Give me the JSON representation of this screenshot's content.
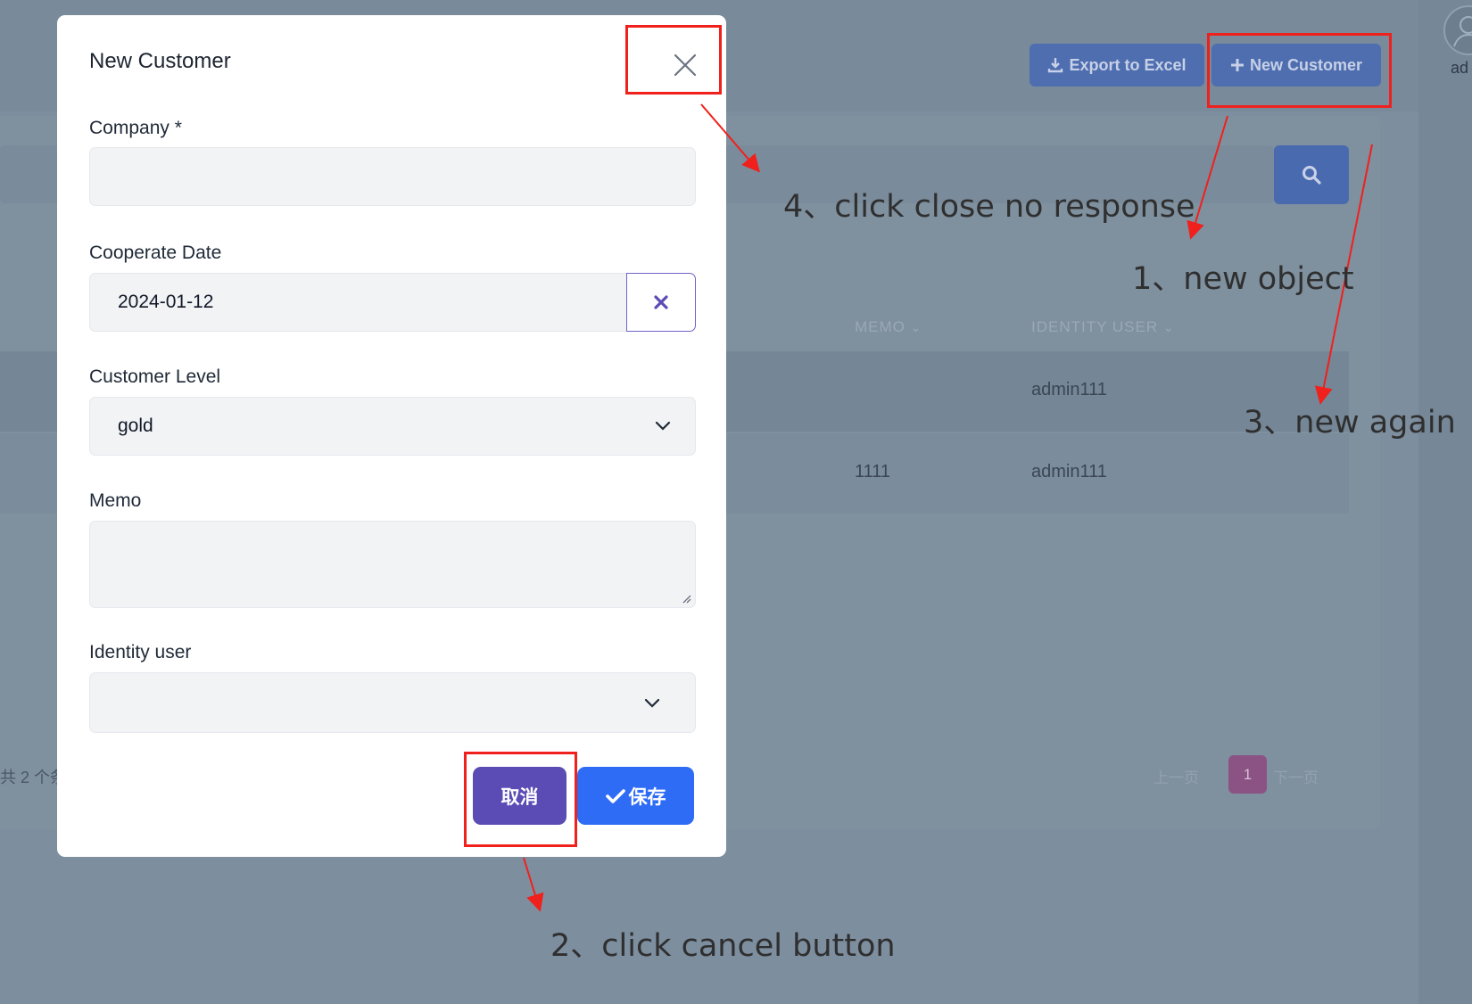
{
  "background": {
    "export_button": "Export to Excel",
    "new_customer_button": "New Customer",
    "avatar_label": "ad",
    "table": {
      "headers": [
        "MEMO",
        "IDENTITY USER"
      ],
      "rows": [
        {
          "memo": "",
          "identity_user": "admin111"
        },
        {
          "memo": "1111",
          "identity_user": "admin111"
        }
      ]
    },
    "total_text": "共 2 个条",
    "pagination": {
      "prev": "上一页",
      "current": "1",
      "next": "下一页"
    }
  },
  "modal": {
    "title": "New Customer",
    "fields": {
      "company": {
        "label": "Company *",
        "value": ""
      },
      "cooperate_date": {
        "label": "Cooperate Date",
        "value": "2024-01-12"
      },
      "customer_level": {
        "label": "Customer Level",
        "value": "gold"
      },
      "memo": {
        "label": "Memo",
        "value": ""
      },
      "identity_user": {
        "label": "Identity user",
        "value": ""
      }
    },
    "cancel_button": "取消",
    "save_button": "保存"
  },
  "annotations": {
    "step1": "1、new object",
    "step2": "2、click cancel button",
    "step3": "3、new again",
    "step4": "4、click close no response",
    "color": "#f0201c"
  }
}
